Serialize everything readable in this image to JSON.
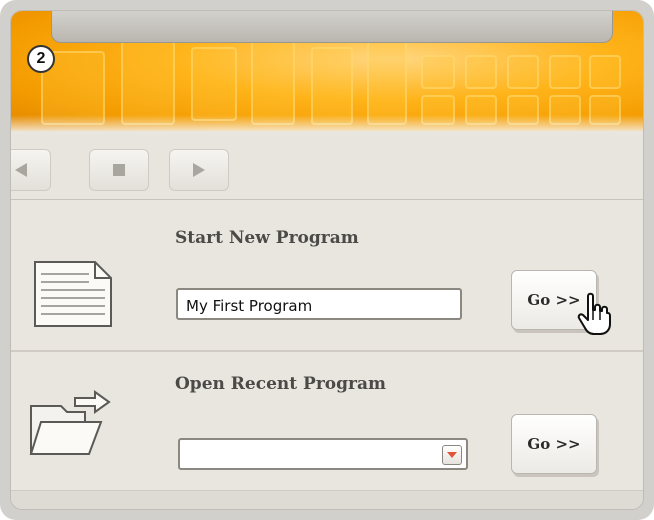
{
  "step_badge": "2",
  "toolbar": {
    "back_icon": "triangle-left-icon",
    "stop_icon": "square-stop-icon",
    "play_icon": "triangle-right-icon"
  },
  "new_program": {
    "title": "Start New Program",
    "input_value": "My First Program",
    "go_label": "Go >>",
    "icon": "document-icon"
  },
  "recent_program": {
    "title": "Open Recent Program",
    "selected_value": "",
    "go_label": "Go >>",
    "icon": "open-folder-icon"
  },
  "colors": {
    "banner_orange": "#f39b00",
    "panel_bg": "#e9e6e0",
    "dropdown_arrow": "#e0553a"
  }
}
